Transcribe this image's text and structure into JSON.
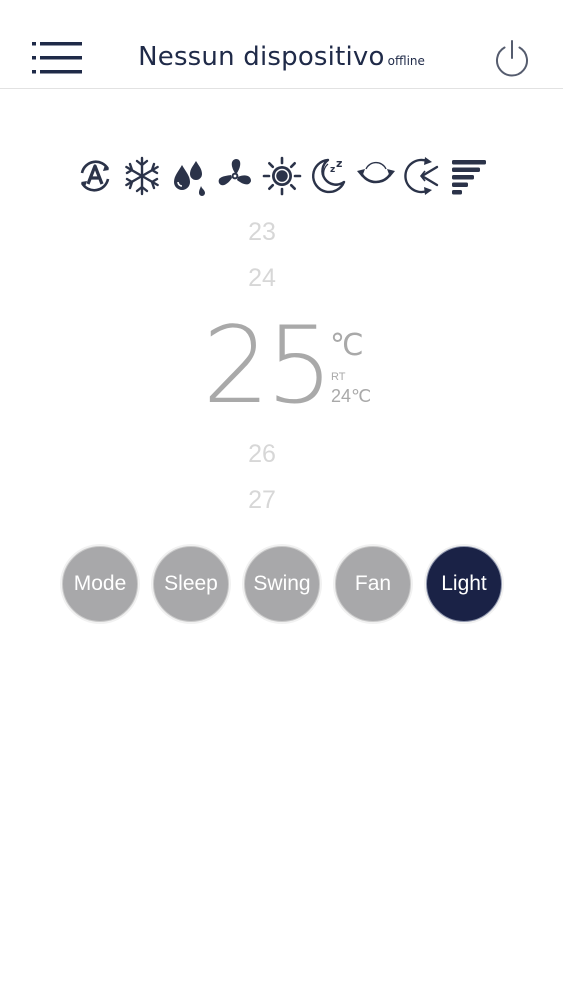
{
  "header": {
    "title": "Nessun dispositivo",
    "status": "offline",
    "menu_icon": "list-menu-icon",
    "power_icon": "power-icon"
  },
  "modes": [
    {
      "icon": "auto-mode-icon"
    },
    {
      "icon": "cool-snowflake-icon"
    },
    {
      "icon": "dry-droplet-icon"
    },
    {
      "icon": "fan-icon"
    },
    {
      "icon": "heat-sun-icon"
    },
    {
      "icon": "sleep-moon-icon"
    },
    {
      "icon": "swing-vertical-icon"
    },
    {
      "icon": "swing-horizontal-icon"
    },
    {
      "icon": "fan-speed-icon"
    }
  ],
  "temperature": {
    "options_above": [
      "23",
      "24"
    ],
    "current": "25",
    "unit": "℃",
    "room_label": "RT",
    "room_value": "24℃",
    "options_below": [
      "26",
      "27"
    ]
  },
  "buttons": [
    {
      "label": "Mode",
      "active": false
    },
    {
      "label": "Sleep",
      "active": false
    },
    {
      "label": "Swing",
      "active": false
    },
    {
      "label": "Fan",
      "active": false
    },
    {
      "label": "Light",
      "active": true
    }
  ],
  "colors": {
    "navy": "#1a2246",
    "grey_button": "#a8a8aa",
    "icon": "#2b3349",
    "temp_text": "#a9a9a9",
    "faded_temp": "#d7d7d7"
  }
}
